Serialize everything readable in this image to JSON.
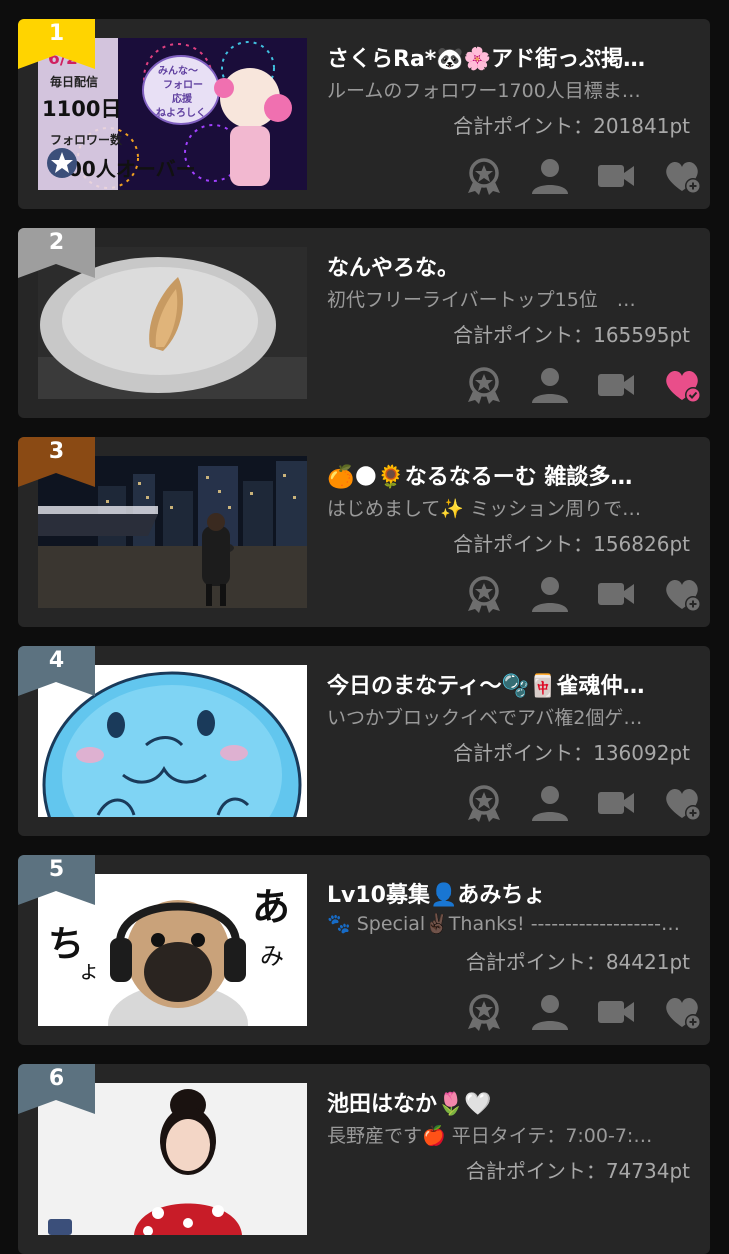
{
  "colors": {
    "background": "#0d0d0d",
    "card": "#262626",
    "icon": "#6e6e6e",
    "favorited": "#e94e8a",
    "rank1": "#ffd400",
    "rank2": "#9e9e9e",
    "rank3": "#8a4a14",
    "rank_other": "#5c7280"
  },
  "rooms": [
    {
      "rank": "1",
      "title": "さくらRa*🐼🌸アド街っぷ掲…",
      "description": "ルームのフォロワー1700人目標ま…",
      "points": "合計ポイント：201841pt",
      "favorited": false,
      "thumb_text": [
        "6/2",
        "毎日配信",
        "1100日",
        "フォロワー数",
        "00人オーバー",
        "みんな〜",
        "フォロー",
        "応援",
        "ねよろしく"
      ]
    },
    {
      "rank": "2",
      "title": "なんやろな。",
      "description": "初代フリーライバートップ15位　…",
      "points": "合計ポイント：165595pt",
      "favorited": true
    },
    {
      "rank": "3",
      "title": "🍊🌑🌻なるなるーむ 雑談多…",
      "description": "はじめまして✨ ミッション周りで…",
      "points": "合計ポイント：156826pt",
      "favorited": false
    },
    {
      "rank": "4",
      "title": "今日のまなティ〜🫧🀄雀魂仲…",
      "description": "いつかブロックイベでアバ権2個ゲ…",
      "points": "合計ポイント：136092pt",
      "favorited": false
    },
    {
      "rank": "5",
      "title": "Lv10募集👤あみちょ",
      "description": "🐾 Special✌🏿Thanks! -------------------…",
      "points": "合計ポイント：84421pt",
      "favorited": false,
      "thumb_text": [
        "あ",
        "み",
        "ち",
        "ょ"
      ]
    },
    {
      "rank": "6",
      "title": "池田はなか🌷🤍",
      "description": "長野産です🍎 平日タイテ：7:00-7:…",
      "points": "合計ポイント：74734pt",
      "favorited": false
    }
  ]
}
